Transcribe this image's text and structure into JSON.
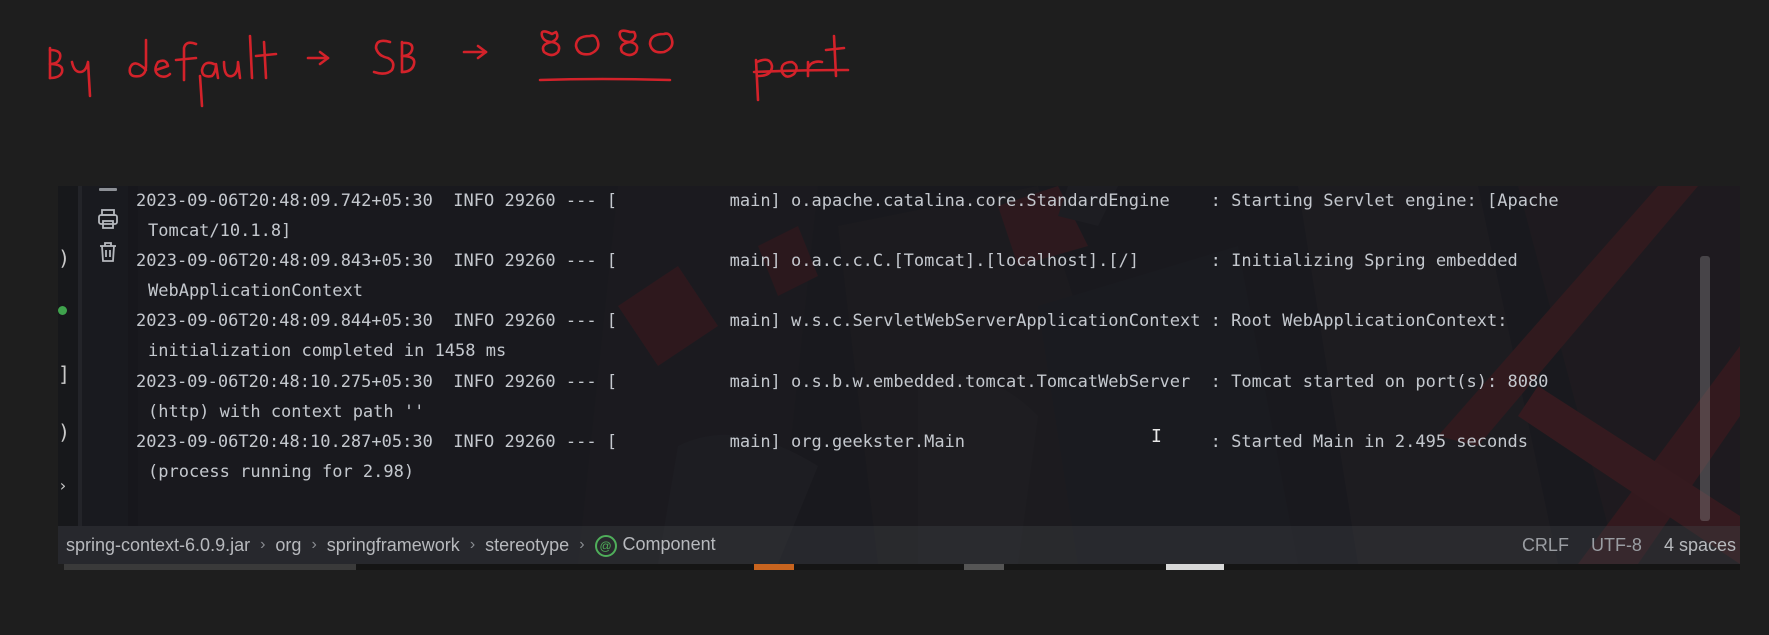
{
  "annotation": {
    "text": "By default → SB → 8080 port",
    "color": "#d3222a"
  },
  "console": {
    "lines": [
      {
        "head": "2023-09-06T20:48:09.742+05:30  INFO 29260 --- [           main] o.apache.catalina.core.StandardEngine    : Starting Servlet engine: [Apache",
        "tail": "Tomcat/10.1.8]"
      },
      {
        "head": "2023-09-06T20:48:09.843+05:30  INFO 29260 --- [           main] o.a.c.c.C.[Tomcat].[localhost].[/]       : Initializing Spring embedded",
        "tail": "WebApplicationContext"
      },
      {
        "head": "2023-09-06T20:48:09.844+05:30  INFO 29260 --- [           main] w.s.c.ServletWebServerApplicationContext : Root WebApplicationContext:",
        "tail": "initialization completed in 1458 ms"
      },
      {
        "head": "2023-09-06T20:48:10.275+05:30  INFO 29260 --- [           main] o.s.b.w.embedded.tomcat.TomcatWebServer  : Tomcat started on port(s): 8080",
        "tail": "(http) with context path ''"
      },
      {
        "head": "2023-09-06T20:48:10.287+05:30  INFO 29260 --- [           main] org.geekster.Main                        : Started Main in 2.495 seconds",
        "tail": "(process running for 2.98)"
      }
    ]
  },
  "tools": {
    "icons": [
      "collapse-icon",
      "print-icon",
      "trash-icon"
    ]
  },
  "gutter": {
    "glyphs": [
      ")",
      "]",
      ")",
      "›"
    ]
  },
  "breadcrumb": {
    "items": [
      "spring-context-6.0.9.jar",
      "org",
      "springframework",
      "stereotype",
      "Component"
    ],
    "separator": "›",
    "component_glyph": "@"
  },
  "status": {
    "line_separator": "CRLF",
    "encoding": "UTF-8",
    "indent": "4 spaces"
  },
  "colors": {
    "accent_red": "#d3222a",
    "component_green": "#4fae5a",
    "background": "#1e1e1e"
  }
}
